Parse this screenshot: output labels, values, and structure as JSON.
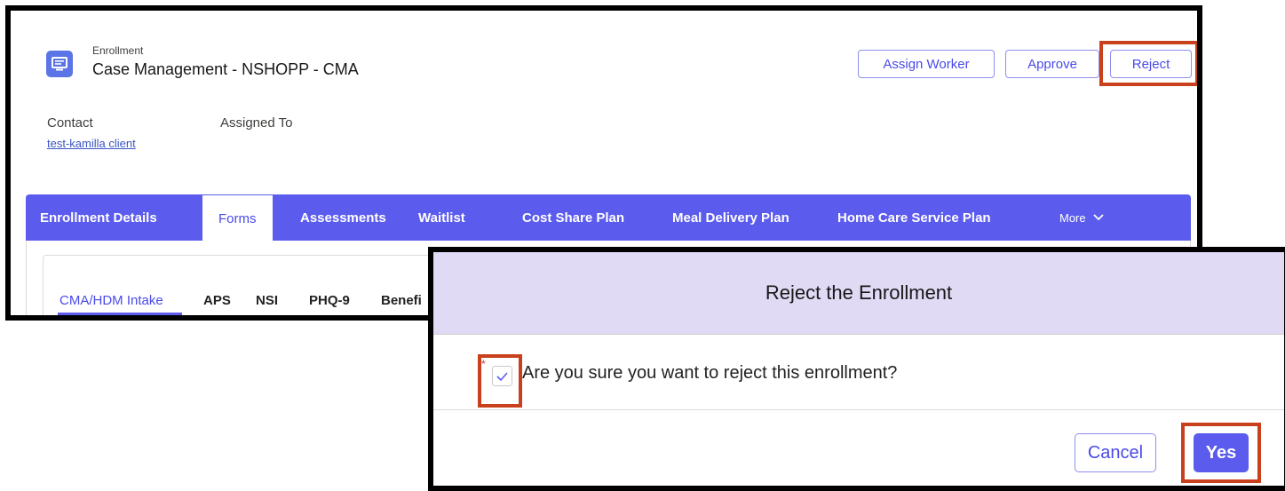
{
  "record": {
    "object_label": "Enrollment",
    "title": "Case Management - NSHOPP - CMA",
    "icon": "enrollment-list-icon",
    "actions": {
      "assign_worker": "Assign Worker",
      "approve": "Approve",
      "reject": "Reject"
    },
    "fields": {
      "contact_label": "Contact",
      "contact_value": "test-kamilla client",
      "assigned_to_label": "Assigned To"
    },
    "tabs": [
      {
        "label": "Enrollment Details"
      },
      {
        "label": "Forms"
      },
      {
        "label": "Assessments"
      },
      {
        "label": "Waitlist"
      },
      {
        "label": "Cost Share Plan"
      },
      {
        "label": "Meal Delivery Plan"
      },
      {
        "label": "Home Care Service Plan"
      },
      {
        "label": "More"
      }
    ],
    "active_tab": "Forms",
    "subtabs": [
      {
        "label": "CMA/HDM Intake"
      },
      {
        "label": "APS"
      },
      {
        "label": "NSI"
      },
      {
        "label": "PHQ-9"
      },
      {
        "label": "Benefi"
      }
    ],
    "active_subtab": "CMA/HDM Intake"
  },
  "modal": {
    "title": "Reject the Enrollment",
    "required_marker": "*",
    "checkbox_label": "Are you sure you want to reject this enrollment?",
    "checkbox_checked": true,
    "cancel_label": "Cancel",
    "yes_label": "Yes"
  },
  "colors": {
    "accent": "#5b5bee",
    "highlight": "#c8401c",
    "modal_header": "#e1daf5"
  }
}
